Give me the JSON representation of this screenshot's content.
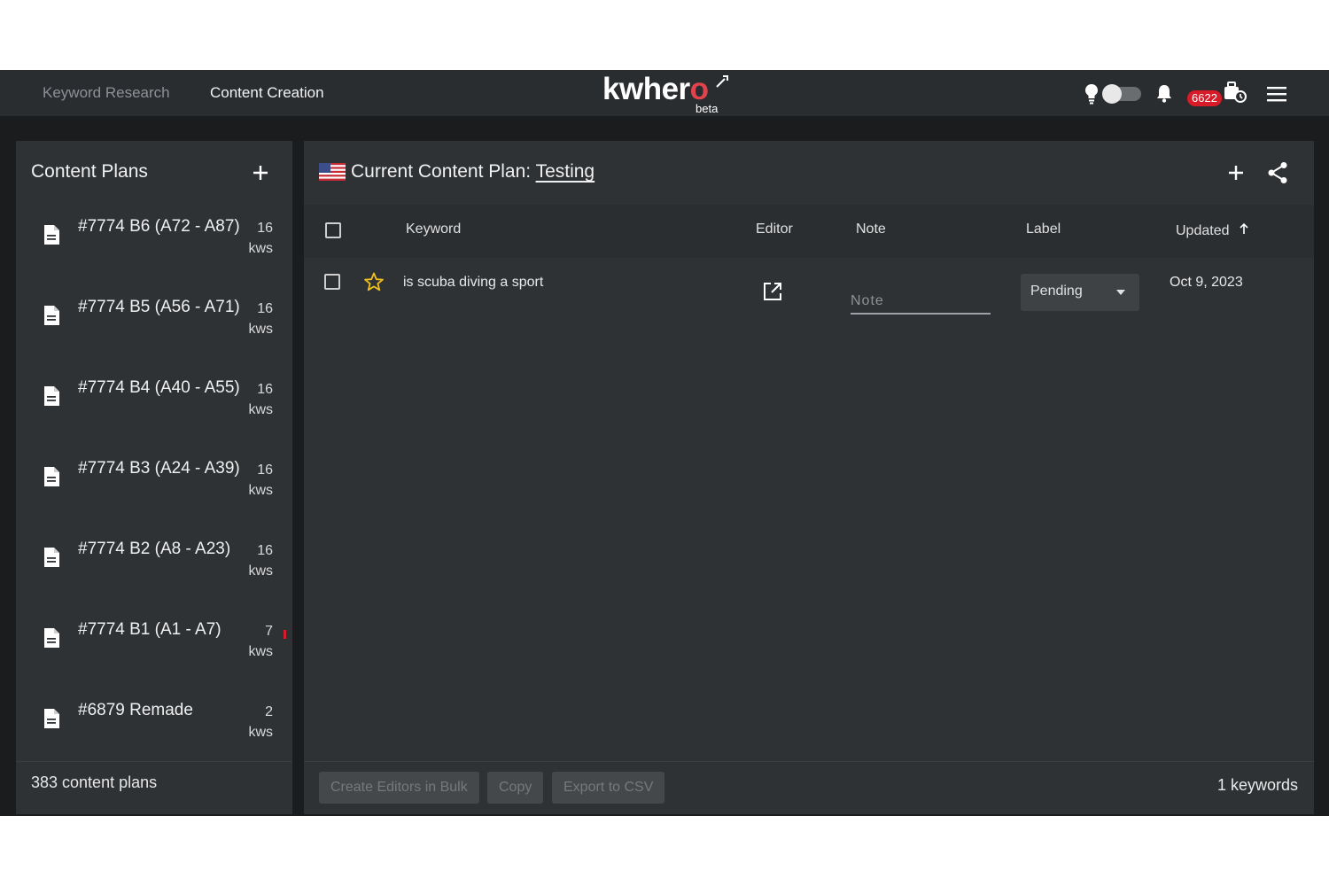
{
  "nav": {
    "links": [
      "Keyword Research",
      "Content Creation"
    ],
    "active_link": "Content Creation",
    "logo_text": "kwhero",
    "logo_subtext": "beta",
    "credits": "6622",
    "icons": [
      "bulb-icon",
      "theme-toggle",
      "bell-icon",
      "toolbox-icon",
      "menu-icon"
    ]
  },
  "sidebar": {
    "title": "Content Plans",
    "plans": [
      {
        "name": "#7774 B6 (A72 - A87)",
        "count": "16",
        "unit": "kws"
      },
      {
        "name": "#7774 B5 (A56 - A71)",
        "count": "16",
        "unit": "kws"
      },
      {
        "name": "#7774 B4 (A40 - A55)",
        "count": "16",
        "unit": "kws"
      },
      {
        "name": "#7774 B3 (A24 - A39)",
        "count": "16",
        "unit": "kws"
      },
      {
        "name": "#7774 B2 (A8 - A23)",
        "count": "16",
        "unit": "kws"
      },
      {
        "name": "#7774 B1 (A1 - A7)",
        "count": "7",
        "unit": "kws"
      },
      {
        "name": "#6879 Remade",
        "count": "2",
        "unit": "kws"
      }
    ],
    "footer": "383 content plans"
  },
  "main": {
    "plan_label": "Current Content Plan:",
    "plan_title": "Testing",
    "columns": {
      "keyword": "Keyword",
      "editor": "Editor",
      "note": "Note",
      "label": "Label",
      "updated": "Updated"
    },
    "rows": [
      {
        "keyword": "is scuba diving a sport",
        "starred": false,
        "note_value": "",
        "note_placeholder": "Note",
        "label": "Pending",
        "updated": "Oct 9, 2023"
      }
    ],
    "footer": {
      "bulk_label": "Create Editors in Bulk",
      "copy_label": "Copy",
      "export_label": "Export to CSV",
      "total": "1 keywords"
    }
  },
  "colors": {
    "background": "#1a1c1e",
    "panel": "#2f3235",
    "accent_red": "#d81b28",
    "star_gold": "#f2c21b"
  }
}
